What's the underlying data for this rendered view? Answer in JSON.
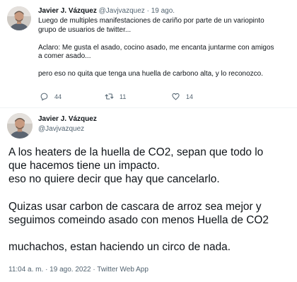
{
  "tweet1": {
    "name": "Javier J. Vázquez",
    "handle": "@Javjvazquez",
    "separator": "·",
    "date": "19 ago.",
    "lines": [
      "Luego de multiples manifestaciones de cariño por parte de un variopinto",
      "grupo de usuarios de twitter..."
    ],
    "lines2": [
      "Aclaro: Me gusta el asado, cocino asado, me encanta juntarme con amigos",
      "a comer asado..."
    ],
    "lines3": [
      "pero eso no quita que tenga una huella de carbono alta, y lo reconozco."
    ],
    "actions": {
      "replies": "44",
      "retweets": "11",
      "likes": "14",
      "reply_icon": "reply-icon",
      "retweet_icon": "retweet-icon",
      "like_icon": "heart-icon"
    }
  },
  "tweet2": {
    "name": "Javier J. Vázquez",
    "handle": "@Javjvazquez",
    "paragraph1": [
      "A los heaters de la huella de CO2, sepan que todo lo",
      "que hacemos tiene un impacto.",
      "eso no quiere decir que hay que cancelarlo."
    ],
    "paragraph2": [
      "Quizas usar carbon de cascara de arroz sea mejor y",
      "seguimos comeindo asado con menos Huella de CO2"
    ],
    "paragraph3": [
      "muchachos, estan haciendo un circo de nada."
    ],
    "meta": "11:04 a. m. · 19 ago. 2022 · Twitter Web App"
  },
  "colors": {
    "text": "#0f1419",
    "muted": "#536471",
    "divider": "#eff3f4"
  }
}
